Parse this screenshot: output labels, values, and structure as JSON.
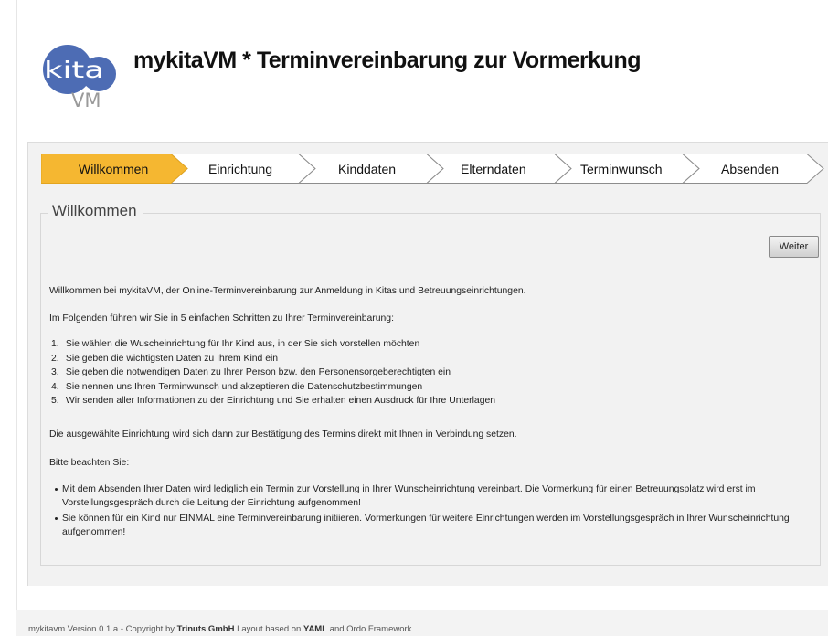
{
  "header": {
    "logo_text_top": "kita",
    "logo_text_bottom": "VM",
    "title": "mykitaVM * Terminvereinbarung zur Vormerkung"
  },
  "colors": {
    "active_step": "#f5b731",
    "inactive_step": "#ffffff",
    "logo_blue": "#4d6cb4",
    "logo_grey": "#9a9a9a",
    "panel_bg": "#f2f2f2"
  },
  "wizard": {
    "active_index": 0,
    "steps": [
      {
        "label": "Willkommen"
      },
      {
        "label": "Einrichtung"
      },
      {
        "label": "Kinddaten"
      },
      {
        "label": "Elterndaten"
      },
      {
        "label": "Terminwunsch"
      },
      {
        "label": "Absenden"
      }
    ]
  },
  "section": {
    "legend": "Willkommen",
    "next_button": "Weiter",
    "intro": "Willkommen bei mykitaVM, der Online-Terminvereinbarung zur Anmeldung in Kitas und Betreuungseinrichtungen.",
    "steps_intro": "Im Folgenden führen wir Sie in 5 einfachen Schritten zu Ihrer Terminvereinbarung:",
    "steps_list": [
      {
        "num": "1.",
        "text": "Sie wählen die Wuscheinrichtung für Ihr Kind aus, in der Sie sich vorstellen möchten"
      },
      {
        "num": "2.",
        "text": "Sie geben die wichtigsten Daten zu Ihrem Kind ein"
      },
      {
        "num": "3.",
        "text": "Sie geben die notwendigen Daten zu Ihrer Person bzw. den Personensorgeberechtigten ein"
      },
      {
        "num": "4.",
        "text": "Sie nennen uns Ihren Terminwunsch und akzeptieren die Datenschutzbestimmungen"
      },
      {
        "num": "5.",
        "text": "Wir senden aller Informationen zu der Einrichtung und Sie erhalten einen Ausdruck für Ihre Unterlagen"
      }
    ],
    "confirmation": "Die ausgewählte Einrichtung wird sich dann zur Bestätigung des Termins direkt mit Ihnen in Verbindung setzen.",
    "notice_title": "Bitte beachten Sie:",
    "notices": [
      "Mit dem Absenden Ihrer Daten wird lediglich ein Termin zur Vorstellung in Ihrer Wunscheinrichtung vereinbart. Die Vormerkung für einen Betreuungsplatz wird erst im Vorstellungsgespräch durch die Leitung der Einrichtung aufgenommen!",
      "Sie können für ein Kind nur EINMAL eine Terminvereinbarung initiieren. Vormerkungen für weitere Einrichtungen werden im Vorstellungsgespräch in Ihrer Wunscheinrichtung aufgenommen!"
    ]
  },
  "footer": {
    "prefix": "mykitavm Version 0.1.a - Copyright by ",
    "company": "Trinuts GmbH",
    "middle": " Layout based on ",
    "framework": "YAML",
    "suffix": " and Ordo Framework"
  }
}
